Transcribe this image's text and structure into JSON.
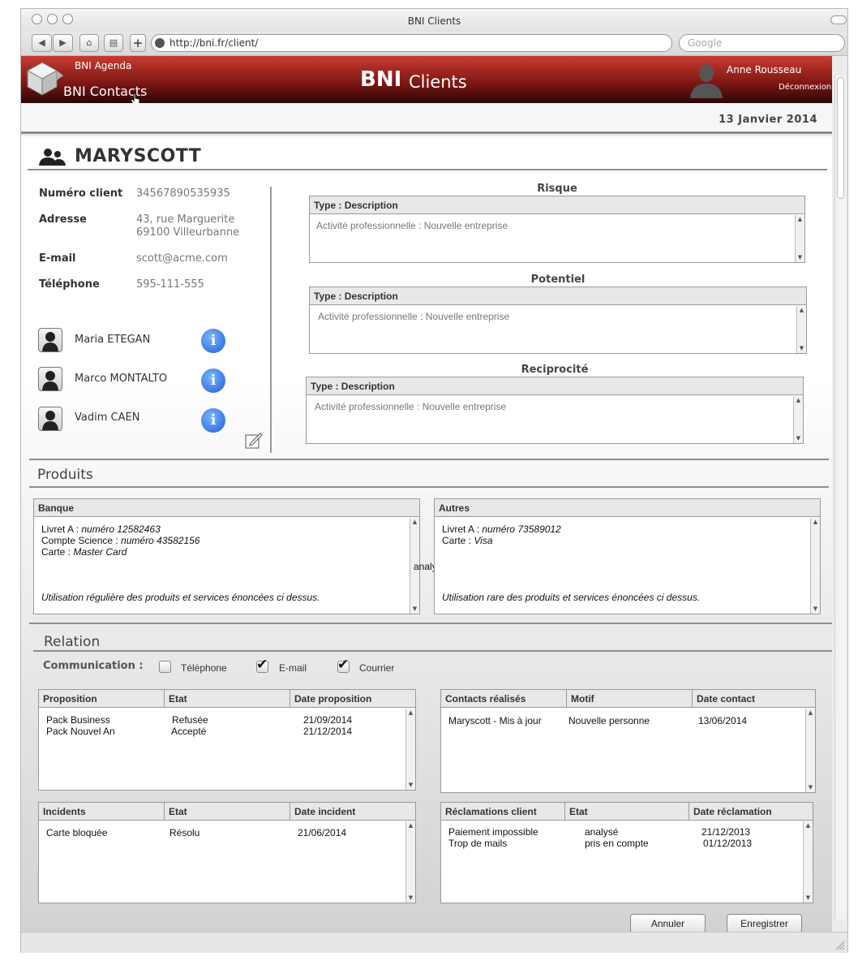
{
  "browser": {
    "title": "BNI Clients",
    "url": "http://bni.fr/client/",
    "search_placeholder": "Google"
  },
  "header": {
    "agenda_link": "BNI Agenda",
    "contacts_link": "BNI Contacts",
    "brand": "BNI",
    "app_title": "Clients",
    "user_name": "Anne Rousseau",
    "logout": "Déconnexion",
    "accent": "#9b1f19"
  },
  "date": "13 Janvier 2014",
  "client": {
    "name": "MARYSCOTT",
    "fields": {
      "numero_label": "Numéro client",
      "numero": "34567890535935",
      "adresse_label": "Adresse",
      "adresse_1": "43, rue Marguerite",
      "adresse_2": "69100 Villeurbanne",
      "email_label": "E-mail",
      "email": "scott@acme.com",
      "tel_label": "Téléphone",
      "tel": "595-111-555"
    },
    "contacts": [
      {
        "name": "Maria ETEGAN"
      },
      {
        "name": "Marco MONTALTO"
      },
      {
        "name": "Vadim CAEN"
      }
    ]
  },
  "assessments": [
    {
      "title": "Risque",
      "head": "Type : Description",
      "text": "Activité professionnelle : Nouvelle entreprise"
    },
    {
      "title": "Potentiel",
      "head": "Type : Description",
      "text": "Activité professionnelle : Nouvelle entreprise"
    },
    {
      "title": "Reciprocité",
      "head": "Type : Description",
      "text": "Activité professionnelle : Nouvelle entreprise"
    }
  ],
  "produits": {
    "title": "Produits",
    "banque": {
      "head": "Banque",
      "line1_a": "Livret A  : ",
      "line1_b": "numéro 12582463",
      "line2_a": "Compte Science : ",
      "line2_b": "numéro  43582156",
      "line3_a": "Carte : ",
      "line3_b": "Master Card",
      "note": "Utilisation régulière des produits et services énoncées ci dessus."
    },
    "autres": {
      "head": "Autres",
      "line1_a": "Livret A  : ",
      "line1_b": "numéro  73589012",
      "line2_a": "Carte : ",
      "line2_b": "Visa",
      "note": "Utilisation rare des produits et services énoncées ci dessus."
    },
    "stray": "analysé"
  },
  "relation": {
    "title": "Relation",
    "communication_label": "Communication :",
    "channels": [
      {
        "label": "Téléphone",
        "checked": false
      },
      {
        "label": "E-mail",
        "checked": true
      },
      {
        "label": "Courrier",
        "checked": true
      }
    ],
    "propositions": {
      "headers": [
        "Proposition",
        "Etat",
        "Date proposition"
      ],
      "rows": [
        [
          "Pack Business",
          "Refusée",
          "21/09/2014"
        ],
        [
          "Pack Nouvel An",
          "Accepté",
          "21/12/2014"
        ]
      ]
    },
    "contacts": {
      "headers": [
        "Contacts réalisés",
        "Motif",
        "Date contact"
      ],
      "rows": [
        [
          "Maryscott - Mis à jour",
          "Nouvelle personne",
          "13/06/2014"
        ]
      ]
    },
    "incidents": {
      "headers": [
        "Incidents",
        "Etat",
        "Date incident"
      ],
      "rows": [
        [
          "Carte bloquée",
          "Résolu",
          "21/06/2014"
        ]
      ]
    },
    "reclamations": {
      "headers": [
        "Réclamations client",
        "Etat",
        "Date réclamation"
      ],
      "rows": [
        [
          "Paiement impossible",
          "analysé",
          "21/12/2013"
        ],
        [
          "Trop de mails",
          "pris en compte",
          "01/12/2013"
        ]
      ]
    }
  },
  "actions": {
    "cancel": "Annuler",
    "save": "Enregistrer"
  }
}
